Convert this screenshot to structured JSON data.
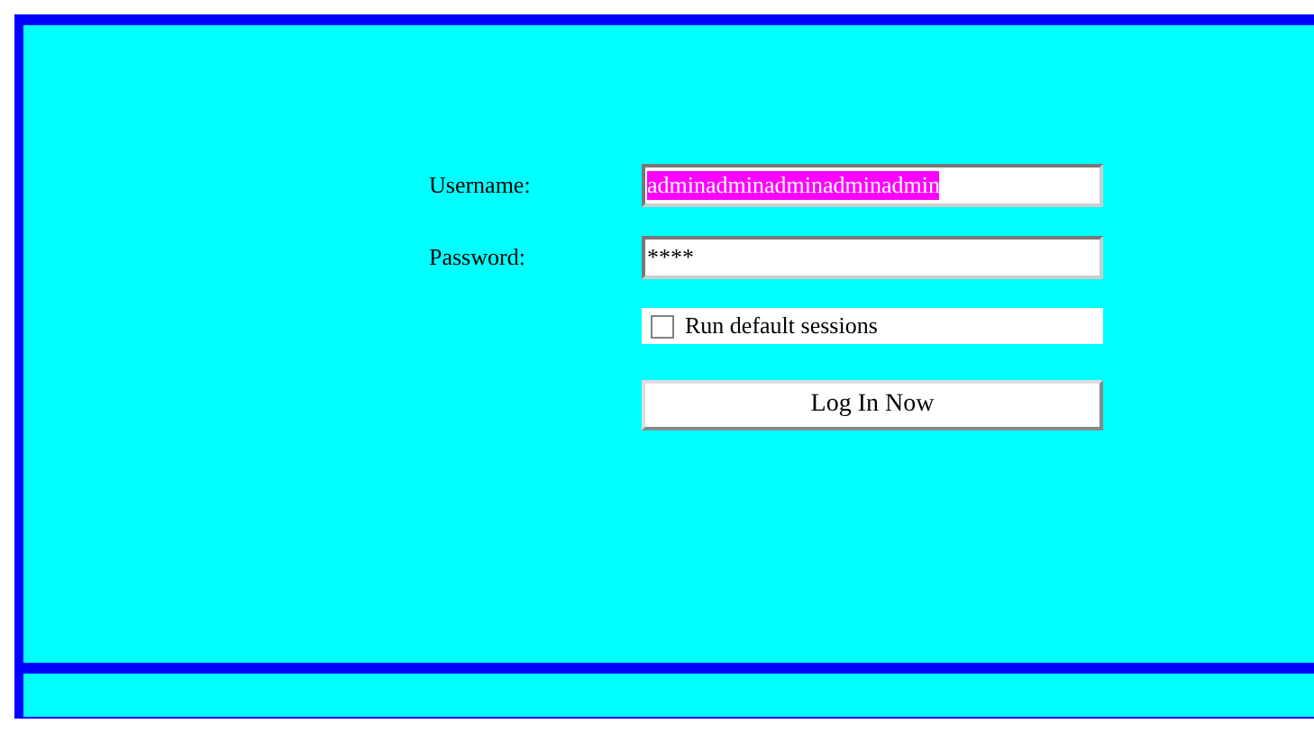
{
  "login_form": {
    "username": {
      "label": "Username:",
      "value": "adminadminadminadminadmin",
      "value_highlighted": true
    },
    "password": {
      "label": "Password:",
      "value": "****"
    },
    "run_default_sessions": {
      "label": "Run default sessions",
      "checked": false
    },
    "submit_button": {
      "label": "Log In Now"
    }
  }
}
